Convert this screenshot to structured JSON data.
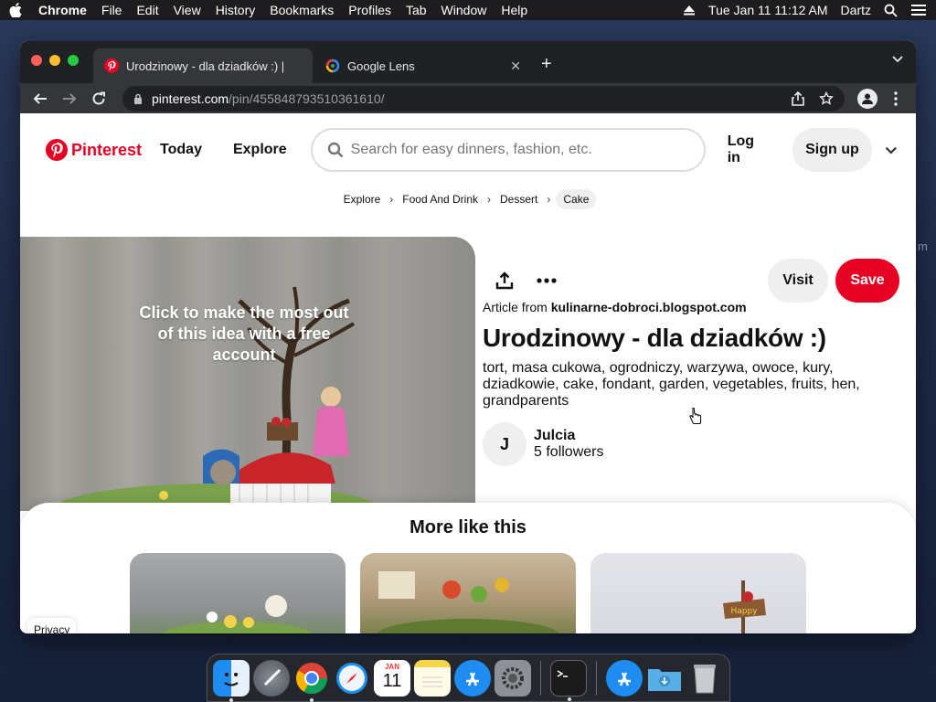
{
  "menubar": {
    "app": "Chrome",
    "items": [
      "File",
      "Edit",
      "View",
      "History",
      "Bookmarks",
      "Profiles",
      "Tab",
      "Window",
      "Help"
    ],
    "datetime": "Tue Jan 11  11:12 AM",
    "user": "Dartz"
  },
  "browser": {
    "tabs": [
      {
        "title": "Urodzinowy - dla dziadków :) |",
        "icon": "pinterest-icon"
      },
      {
        "title": "Google Lens",
        "icon": "google-lens-icon"
      }
    ],
    "url_host": "pinterest.com",
    "url_path": "/pin/455848793510361610/"
  },
  "header": {
    "logo": "Pinterest",
    "today": "Today",
    "explore": "Explore",
    "search_placeholder": "Search for easy dinners, fashion, etc.",
    "login": "Log in",
    "signup": "Sign up"
  },
  "breadcrumb": [
    "Explore",
    "Food And Drink",
    "Dessert",
    "Cake"
  ],
  "pin": {
    "overlay_text": "Click to make the most out of this idea with a free account",
    "visit": "Visit",
    "save": "Save",
    "article_prefix": "Article from",
    "article_source": "kulinarne-dobroci.blogspot.com",
    "title": "Urodzinowy - dla dziadków :)",
    "description": "tort, masa cukowa, ogrodniczy, warzywa, owoce, kury, dziadkowie, cake, fondant, garden, vegetables, fruits, hen, grandparents",
    "author_initial": "J",
    "author_name": "Julcia",
    "author_followers": "5 followers"
  },
  "more": {
    "title": "More like this",
    "privacy": "Privacy"
  },
  "dock": {
    "calendar_month": "JAN",
    "calendar_day": "11"
  },
  "colors": {
    "brand": "#e60023",
    "chrome_dark": "#202124",
    "chrome_tab": "#35363a"
  }
}
